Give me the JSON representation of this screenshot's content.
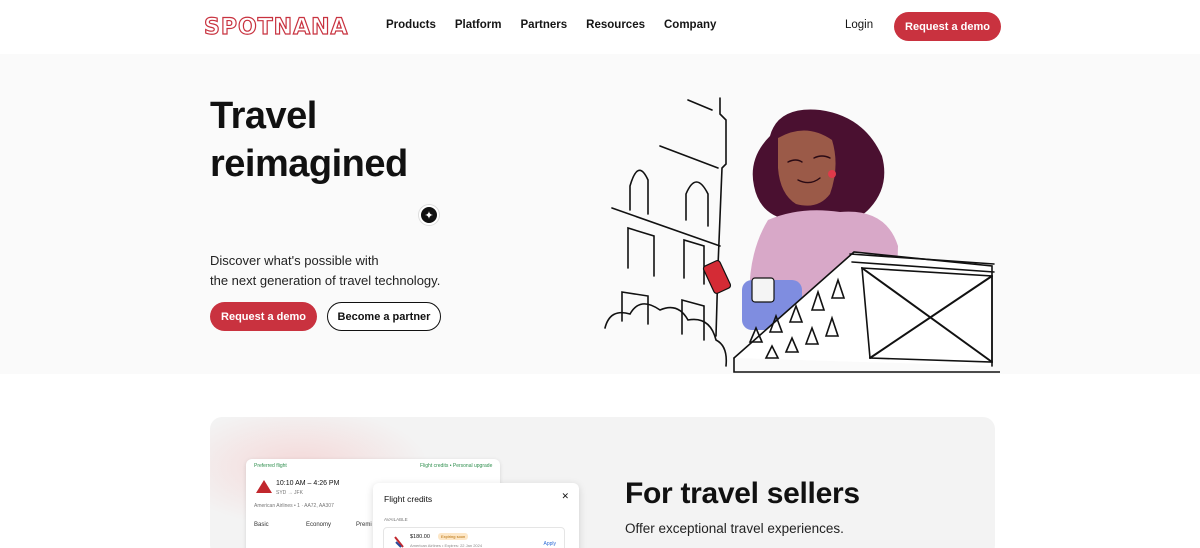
{
  "header": {
    "logo_text": "SPOTNANA",
    "nav": [
      "Products",
      "Platform",
      "Partners",
      "Resources",
      "Company"
    ],
    "login_label": "Login",
    "demo_label": "Request a demo"
  },
  "hero": {
    "title_line1": "Travel",
    "title_line2": "reimagined",
    "subtitle_line1": "Discover what's possible with",
    "subtitle_line2": "the next generation of travel technology.",
    "primary_button": "Request a demo",
    "secondary_button": "Become a partner",
    "badge_icon": "sparkle-chat-icon"
  },
  "sellers": {
    "title": "For travel sellers",
    "subtitle": "Offer exceptional travel experiences.",
    "screenshot": {
      "preferred_label": "Preferred flight",
      "flight_tags": "Flight credits • Personal upgrade",
      "time": "10:10 AM – 4:26 PM",
      "route": "SYD → JFK",
      "carrier": "American Airlines • 1 · AA72, AA307",
      "fare_columns": [
        "Basic",
        "Economy",
        "Premi"
      ],
      "popup_title": "Flight credits",
      "close_icon": "close-icon",
      "available_label": "AVAILABLE",
      "credit_amount": "$180.00",
      "credit_badge": "Expiring soon",
      "credit_desc": "American Airlines • Expires: 22 Jan 2024",
      "apply_label": "Apply"
    }
  },
  "colors": {
    "brand_red": "#c9323f",
    "hero_bg": "#fafafa",
    "card_bg": "#f3f3f3"
  }
}
